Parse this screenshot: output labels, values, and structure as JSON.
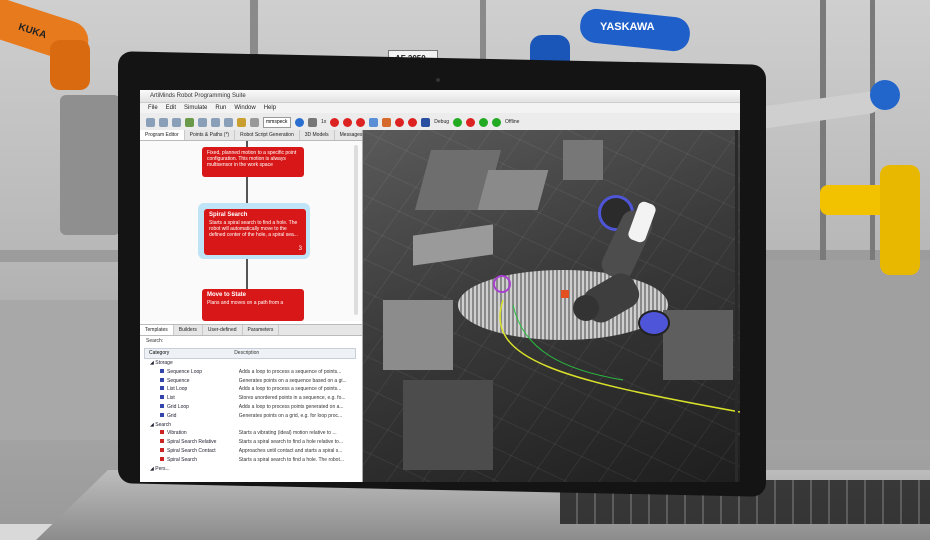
{
  "background": {
    "brand_right": "YASKAWA",
    "brand_left": "KUKA",
    "sign": "AF 2050",
    "colors": {
      "kuka_orange": "#e87a1e",
      "yaskawa_blue": "#1f5fc9",
      "fanuc_yellow": "#f2c200"
    }
  },
  "app": {
    "title": "ArtiMinds Robot Programming Suite",
    "menu": [
      "File",
      "Edit",
      "Simulate",
      "Run",
      "Window",
      "Help"
    ],
    "toolbar": {
      "select_value": "mmspeck",
      "speed_label": "1x",
      "debug_label": "Debug",
      "offline_label": "Offline"
    },
    "left_tabs": [
      "Program Editor",
      "Points & Paths (*)",
      "Robot Script Generation",
      "3D Models",
      "Messages"
    ],
    "blocks": [
      {
        "title": "",
        "text": "Fixed, planned motion to a specific point configuration. This motion is always multisensor in the work space"
      },
      {
        "title": "Spiral Search",
        "text": "Starts a spiral search to find a hole. The robot will automatically move to the defined center of the hole, a spiral sea...",
        "badge": "3"
      },
      {
        "title": "Move to State",
        "text": "Plans and moves on a path from a"
      }
    ],
    "bottom_tabs": [
      "Templates",
      "Builders",
      "User-defined",
      "Parameters"
    ],
    "search_label": "Search:",
    "columns": [
      "Category",
      "Description"
    ],
    "tree": [
      {
        "name": "Storage",
        "desc": "",
        "type": "group"
      },
      {
        "name": "Sequence Loop",
        "desc": "Adds a loop to process a sequence of points...",
        "type": "blue"
      },
      {
        "name": "Sequence",
        "desc": "Generates points on a sequence based on a gi...",
        "type": "blue"
      },
      {
        "name": "List Loop",
        "desc": "Adds a loop to process a sequence of points...",
        "type": "blue"
      },
      {
        "name": "List",
        "desc": "Stores unordered points in a sequence, e.g. fo...",
        "type": "blue"
      },
      {
        "name": "Grid Loop",
        "desc": "Adds a loop to process points generated on a...",
        "type": "blue"
      },
      {
        "name": "Grid",
        "desc": "Generates points on a grid, e.g. for loop proc...",
        "type": "blue"
      },
      {
        "name": "Search",
        "desc": "",
        "type": "group"
      },
      {
        "name": "Vibration",
        "desc": "Starts a vibrating (ideal) motion relative to ...",
        "type": "red"
      },
      {
        "name": "Spiral Search Relative",
        "desc": "Starts a spiral search to find a hole relative to...",
        "type": "red"
      },
      {
        "name": "Spiral Search Contact",
        "desc": "Approaches until contact and starts a spiral s...",
        "type": "red"
      },
      {
        "name": "Spiral Search",
        "desc": "Starts a spiral search to find a hole. The robot...",
        "type": "red"
      },
      {
        "name": "Pers...",
        "desc": "",
        "type": "group"
      }
    ]
  }
}
